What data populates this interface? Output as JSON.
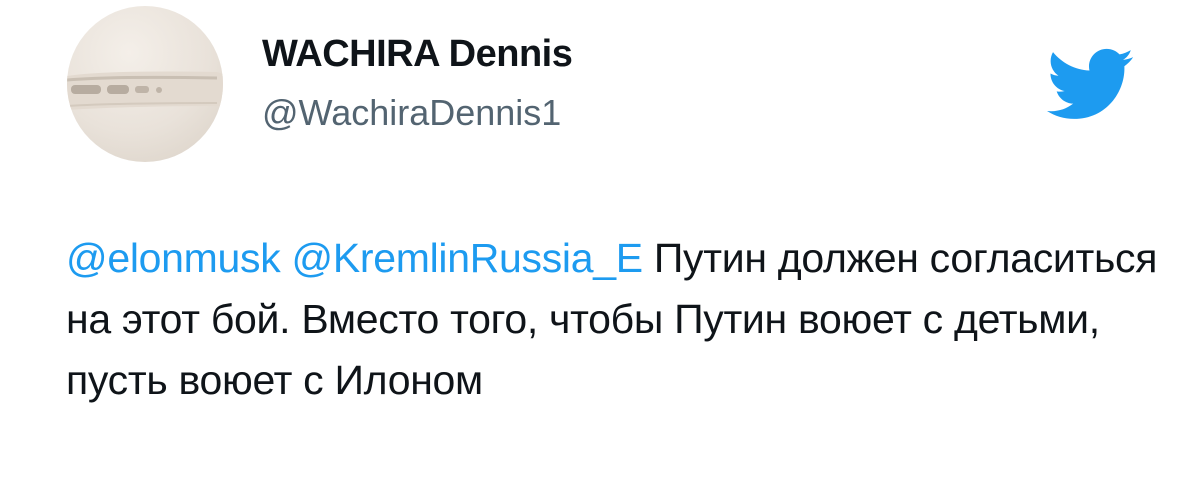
{
  "tweet": {
    "author": {
      "display_name": "WACHIRA Dennis",
      "handle": "@WachiraDennis1",
      "avatar_icon": "avatar-photo-phone-edge"
    },
    "brand": {
      "icon": "twitter-bird-icon",
      "color": "#1d9bf0"
    },
    "mentions": [
      "@elonmusk",
      "@KremlinRussia_E"
    ],
    "body": "Путин должен согласиться на этот бой. Вместо того, чтобы Путин воюет с детьми, пусть воюет с Илоном",
    "colors": {
      "mention": "#1d9bf0",
      "text": "#0f1419",
      "handle": "#536471"
    }
  }
}
